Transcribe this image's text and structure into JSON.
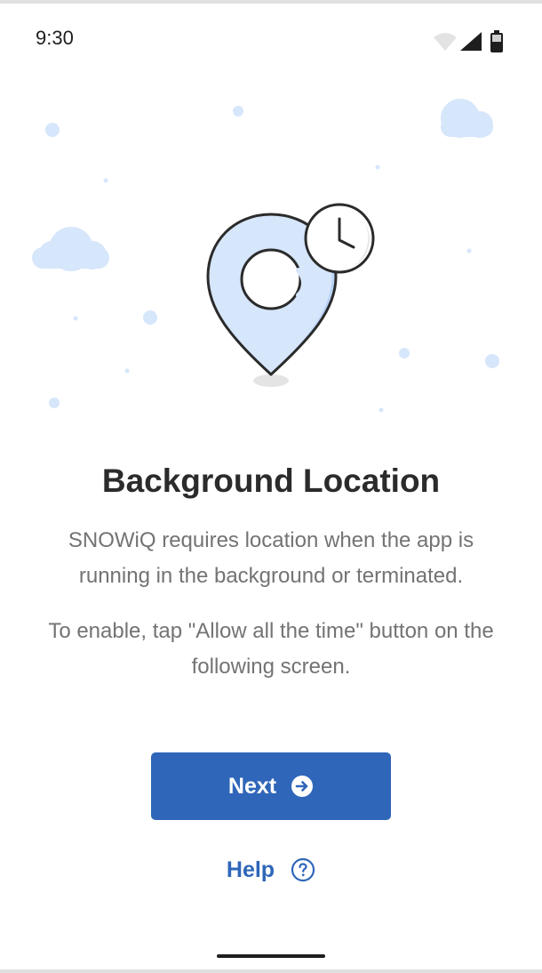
{
  "status_bar": {
    "time": "9:30",
    "icons": [
      "wifi-icon",
      "cell-signal-icon",
      "battery-icon"
    ]
  },
  "illustration": {
    "icons": [
      "location-pin-icon",
      "clock-icon",
      "cloud-icon"
    ]
  },
  "content": {
    "title": "Background Location",
    "description": "SNOWiQ requires location when the app is running in the background or terminated.",
    "instruction": "To enable, tap \"Allow all the time\" button on the following screen."
  },
  "actions": {
    "next_label": "Next",
    "next_icon": "arrow-right-circle-icon",
    "help_label": "Help",
    "help_icon": "question-circle-icon"
  },
  "colors": {
    "accent": "#2f66b9",
    "illustration_fill": "#d6e6fb",
    "illustration_shade": "#b9d3f5",
    "text_primary": "#2b2b2b",
    "text_secondary": "#737373"
  }
}
